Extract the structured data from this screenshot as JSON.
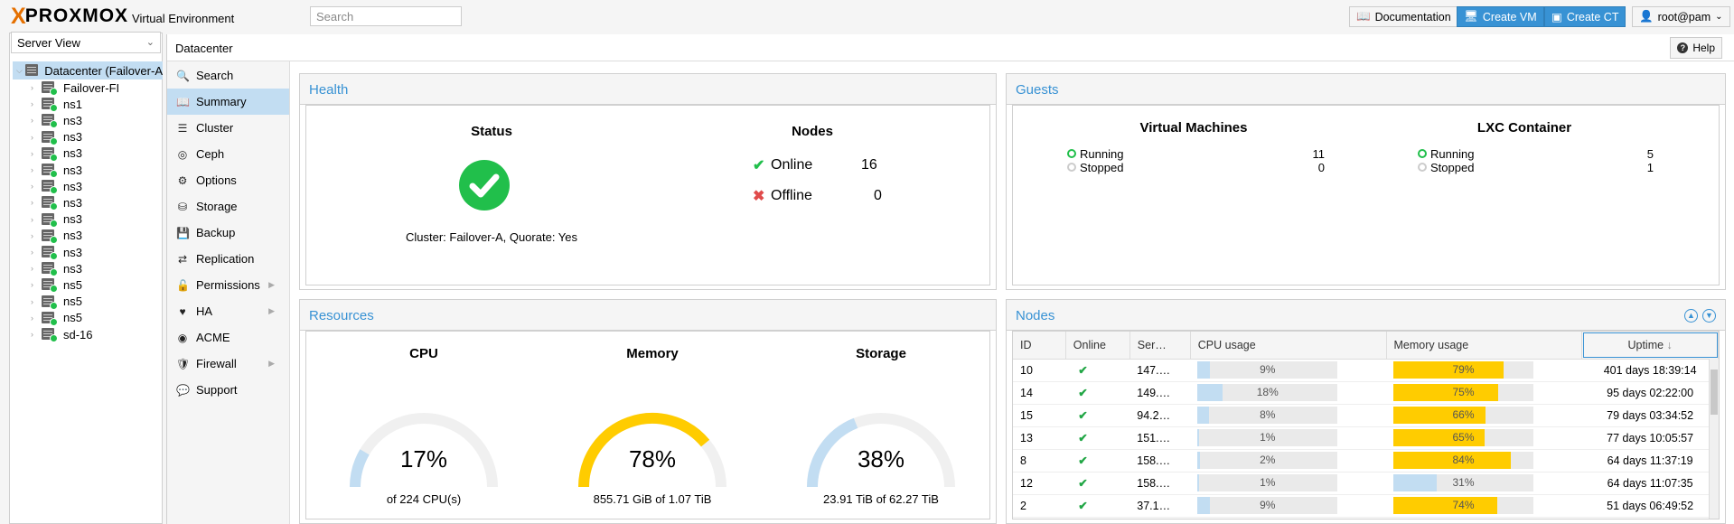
{
  "header": {
    "logo_x": "X",
    "logo_text": "PROXMOX",
    "logo_sub": "Virtual Environment",
    "search_placeholder": "Search",
    "documentation": "Documentation",
    "create_vm": "Create VM",
    "create_ct": "Create CT",
    "user": "root@pam"
  },
  "tree": {
    "view": "Server View",
    "root": "Datacenter (Failover-A",
    "nodes": [
      "Failover-FI",
      "ns1",
      "ns3",
      "ns3",
      "ns3",
      "ns3",
      "ns3",
      "ns3",
      "ns3",
      "ns3",
      "ns3",
      "ns3",
      "ns5",
      "ns5",
      "ns5",
      "sd-16"
    ]
  },
  "content": {
    "title": "Datacenter",
    "help": "Help"
  },
  "nav": [
    "Search",
    "Summary",
    "Cluster",
    "Ceph",
    "Options",
    "Storage",
    "Backup",
    "Replication",
    "Permissions",
    "HA",
    "ACME",
    "Firewall",
    "Support"
  ],
  "health": {
    "title": "Health",
    "status_heading": "Status",
    "cluster_text": "Cluster: Failover-A, Quorate: Yes",
    "nodes_heading": "Nodes",
    "online_label": "Online",
    "online_count": "16",
    "offline_label": "Offline",
    "offline_count": "0"
  },
  "guests": {
    "title": "Guests",
    "vm_heading": "Virtual Machines",
    "vm_running_label": "Running",
    "vm_running": "11",
    "vm_stopped_label": "Stopped",
    "vm_stopped": "0",
    "lxc_heading": "LXC Container",
    "lxc_running_label": "Running",
    "lxc_running": "5",
    "lxc_stopped_label": "Stopped",
    "lxc_stopped": "1"
  },
  "resources": {
    "title": "Resources",
    "cpu_heading": "CPU",
    "cpu_pct": "17%",
    "cpu_value": 0.17,
    "cpu_sub": "of 224 CPU(s)",
    "mem_heading": "Memory",
    "mem_pct": "78%",
    "mem_value": 0.78,
    "mem_sub": "855.71 GiB of 1.07 TiB",
    "sto_heading": "Storage",
    "sto_pct": "38%",
    "sto_value": 0.38,
    "sto_sub": "23.91 TiB of 62.27 TiB"
  },
  "nodes_panel": {
    "title": "Nodes",
    "columns": [
      "ID",
      "Online",
      "Ser…",
      "CPU usage",
      "Memory usage",
      "Uptime"
    ],
    "rows": [
      {
        "id": "10",
        "server": "147.…",
        "cpu": 0.09,
        "cpu_txt": "9%",
        "mem": 0.79,
        "mem_txt": "79%",
        "uptime": "401 days 18:39:14"
      },
      {
        "id": "14",
        "server": "149.…",
        "cpu": 0.18,
        "cpu_txt": "18%",
        "mem": 0.75,
        "mem_txt": "75%",
        "uptime": "95 days 02:22:00"
      },
      {
        "id": "15",
        "server": "94.2…",
        "cpu": 0.08,
        "cpu_txt": "8%",
        "mem": 0.66,
        "mem_txt": "66%",
        "uptime": "79 days 03:34:52"
      },
      {
        "id": "13",
        "server": "151.…",
        "cpu": 0.01,
        "cpu_txt": "1%",
        "mem": 0.65,
        "mem_txt": "65%",
        "uptime": "77 days 10:05:57"
      },
      {
        "id": "8",
        "server": "158.…",
        "cpu": 0.02,
        "cpu_txt": "2%",
        "mem": 0.84,
        "mem_txt": "84%",
        "uptime": "64 days 11:37:19"
      },
      {
        "id": "12",
        "server": "158.…",
        "cpu": 0.01,
        "cpu_txt": "1%",
        "mem": 0.31,
        "mem_txt": "31%",
        "uptime": "64 days 11:07:35"
      },
      {
        "id": "2",
        "server": "37.1…",
        "cpu": 0.09,
        "cpu_txt": "9%",
        "mem": 0.74,
        "mem_txt": "74%",
        "uptime": "51 days 06:49:52"
      }
    ]
  },
  "colors": {
    "accent": "#3892d4",
    "ok": "#21bf4b",
    "warn": "#ffcc00",
    "light_blue": "#c2ddf2"
  }
}
